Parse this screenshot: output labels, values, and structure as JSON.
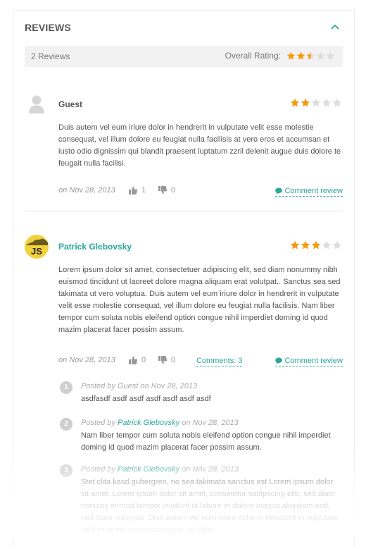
{
  "section": {
    "title": "REVIEWS"
  },
  "summary": {
    "count_text": "2 Reviews",
    "overall_label": "Overall Rating:",
    "overall_rating": 2.5,
    "max_rating": 5
  },
  "colors": {
    "accent": "#2aa79b",
    "star_filled": "#f39c12",
    "star_empty": "#dddddd"
  },
  "reviews": [
    {
      "author": "Guest",
      "avatar": "user-silhouette-icon",
      "rating": 2,
      "text": "Duis autem vel eum iriure dolor in hendrerit in vulputate velit esse molestie consequat, vel illum dolore eu feugiat nulla facilisis at vero eros et accumsan et iusto odio dignissim qui blandit praesent luptatum zzril delenit augue duis dolore te feugait nulla facilisi.",
      "date": "on Nov 28, 2013",
      "likes": "1",
      "dislikes": "0",
      "comment_review_label": "Comment review"
    },
    {
      "author": "Patrick Glebovsky",
      "avatar_text": "JS",
      "rating": 3,
      "text": "Lorem ipsum dolor sit amet, consectetuer adipiscing elit, sed diam nonummy nibh euismod tincidunt ut laoreet dolore magna aliquam erat volutpat.. Sanctus sea sed takimata ut vero voluptua. Duis autem vel eum iriure dolor in hendrerit in vulputate velit esse molestie consequat, vel illum dolore eu feugiat nulla facilisis. Nam liber tempor cum soluta nobis eleifend option congue nihil imperdiet doming id quod mazim placerat facer possim assum.",
      "date": "on Nov 28, 2013",
      "likes": "0",
      "dislikes": "0",
      "comments_label": "Comments: 3",
      "comment_review_label": "Comment review"
    }
  ],
  "comments": [
    {
      "number": "1",
      "posted_by": "Posted by",
      "author": "Guest",
      "date": "on Nov 28, 2013",
      "text": "asdfasdf asdf asdf asdf asdf asdf asdf"
    },
    {
      "number": "2",
      "posted_by": "Posted by",
      "author": "Patrick Glebovsky",
      "date": "on Nov 28, 2013",
      "text": "Nam liber tempor cum soluta nobis eleifend option congue nihil imperdiet doming id quod mazim placerat facer possim assum."
    },
    {
      "number": "3",
      "posted_by": "Posted by",
      "author": "Patrick Glebovsky",
      "date": "on Nov 28, 2013",
      "text": "Stet clita kasd gubergren, no sea takimata sanctus est Lorem ipsum dolor sit amet. Lorem ipsum dolor sit amet, consetetur sadipscing elitr, sed diam nonumy eirmod tempor invidunt ut labore et dolore magna aliquyam erat, sed diam voluptua. Duis autem vel eum iriure dolor in hendrerit in vulputate velit esse molestie consequat, vel illum"
    }
  ]
}
